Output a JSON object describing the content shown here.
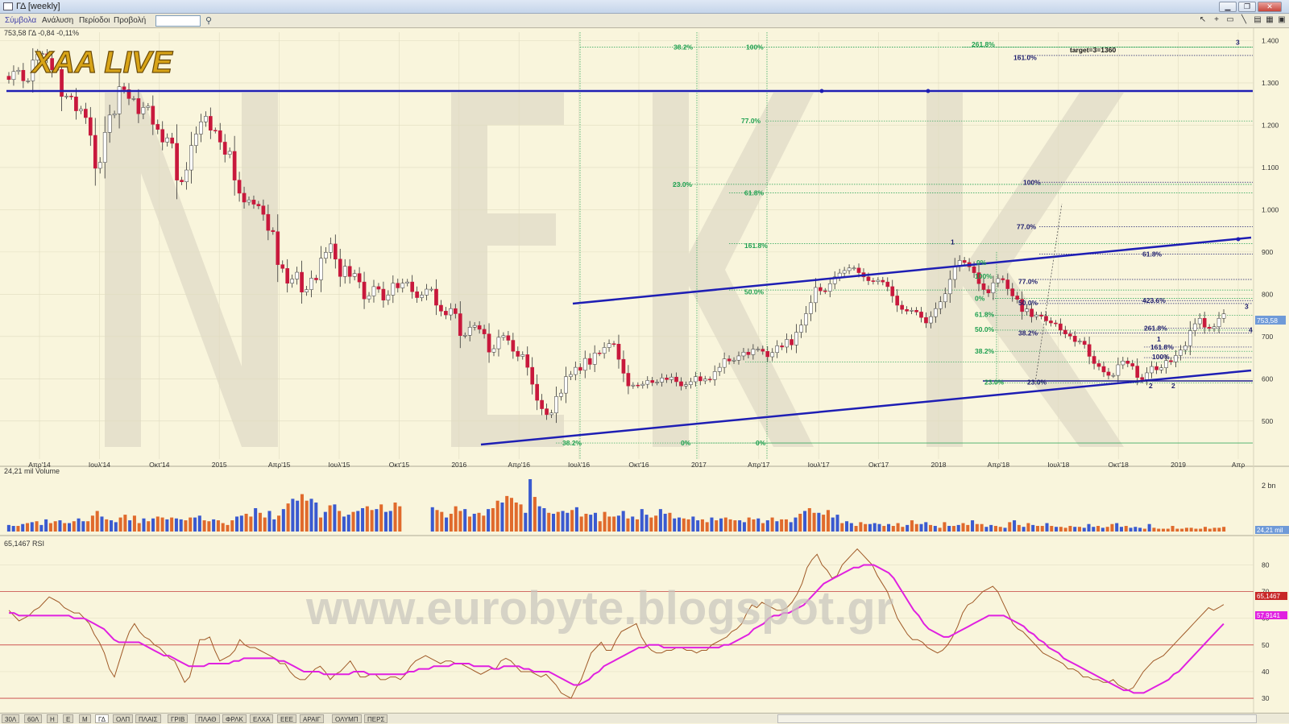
{
  "window": {
    "title": "ΓΔ [weekly]",
    "buttons": [
      "▁",
      "❐",
      "✕"
    ]
  },
  "menu": {
    "items": [
      "Σύμβολα",
      "Ανάλυση",
      "Περίοδοι",
      "Προβολή"
    ]
  },
  "toolbar_icons": [
    "cursor-icon",
    "crosshair-icon",
    "zoom-box-icon",
    "trendline-icon",
    "layout-icon",
    "grid-icon",
    "save-icon"
  ],
  "watermark": {
    "logo": "XAA LIVE",
    "letters": "NEK",
    "url": "www.eurobyte.blogspot.gr"
  },
  "colors": {
    "up": "#ffffff",
    "down": "#c8183c",
    "wick": "#333333",
    "trend": "#1e1eb4",
    "fib_green": "#1fa050",
    "fib_navy": "#1e1e6e",
    "vol_up": "#3a5ad0",
    "vol_down": "#e06a2c",
    "rsi": "#a05a28",
    "rsi_ma": "#e020e0",
    "rsi_level": "#c84040",
    "grid": "#e0dcc0"
  },
  "chart_data": [
    {
      "panel": "price",
      "type": "candlestick",
      "legend": "753,58 ΓΔ -0,84 -0,11%",
      "last_label": "753,58",
      "x_ticks": [
        "Απρ'14",
        "Ιουλ'14",
        "Οκτ'14",
        "2015",
        "Απρ'15",
        "Ιουλ'15",
        "Οκτ'15",
        "2016",
        "Απρ'16",
        "Ιουλ'16",
        "Οκτ'16",
        "2017",
        "Απρ'17",
        "Ιουλ'17",
        "Οκτ'17",
        "2018",
        "Απρ'18",
        "Ιουλ'18",
        "Οκτ'18",
        "2019",
        "Απρ"
      ],
      "y_ticks": [
        "1.400",
        "1.300",
        "1.200",
        "1.100",
        "1.000",
        "900",
        "800",
        "700",
        "600",
        "500"
      ],
      "ylim": [
        410,
        1420
      ],
      "closes": [
        1308,
        1327,
        1330,
        1305,
        1305,
        1354,
        1368,
        1369,
        1358,
        1331,
        1332,
        1268,
        1269,
        1267,
        1234,
        1238,
        1218,
        1176,
        1098,
        1112,
        1183,
        1224,
        1227,
        1291,
        1284,
        1263,
        1263,
        1227,
        1242,
        1245,
        1202,
        1190,
        1160,
        1170,
        1157,
        1070,
        1066,
        1094,
        1152,
        1179,
        1208,
        1221,
        1188,
        1187,
        1160,
        1131,
        1138,
        1070,
        1039,
        1018,
        1023,
        1013,
        1009,
        989,
        951,
        948,
        870,
        861,
        826,
        836,
        852,
        805,
        811,
        838,
        834,
        885,
        899,
        919,
        883,
        842,
        866,
        842,
        849,
        829,
        789,
        796,
        818,
        812,
        786,
        798,
        826,
        815,
        826,
        829,
        806,
        792,
        798,
        812,
        812,
        774,
        760,
        751,
        766,
        754,
        702,
        703,
        722,
        726,
        717,
        706,
        663,
        671,
        698,
        702,
        691,
        665,
        653,
        657,
        627,
        587,
        549,
        529,
        515,
        519,
        558,
        566,
        605,
        610,
        627,
        620,
        648,
        634,
        661,
        660,
        674,
        683,
        682,
        646,
        613,
        583,
        585,
        584,
        587,
        596,
        591,
        592,
        602,
        598,
        604,
        593,
        583,
        586,
        593,
        605,
        595,
        599,
        598,
        617,
        627,
        647,
        642,
        644,
        654,
        663,
        657,
        670,
        670,
        665,
        652,
        662,
        678,
        675,
        693,
        680,
        710,
        727,
        754,
        780,
        816,
        808,
        807,
        825,
        841,
        850,
        856,
        862,
        862,
        851,
        841,
        832,
        830,
        833,
        829,
        818,
        796,
        774,
        764,
        760,
        762,
        758,
        745,
        732,
        747,
        766,
        782,
        801,
        835,
        866,
        880,
        875,
        865,
        851,
        825,
        811,
        803,
        827,
        837,
        834,
        813,
        796,
        788,
        759,
        765,
        747,
        751,
        748,
        737,
        732,
        730,
        715,
        706,
        701,
        688,
        689,
        681,
        653,
        636,
        629,
        616,
        608,
        608,
        633,
        642,
        636,
        630,
        603,
        598,
        614,
        629,
        621,
        626,
        643,
        640,
        655,
        668,
        678,
        714,
        730,
        743,
        722,
        719,
        723,
        743,
        753.58
      ]
    },
    {
      "panel": "volume",
      "type": "bar",
      "legend": "24,21 mil Volume",
      "y_ticks": [
        "2 bn"
      ],
      "last_label": "24,21 mil",
      "values": [
        7,
        6,
        6,
        8,
        9,
        10,
        11,
        7,
        13,
        9,
        11,
        12,
        9,
        9,
        11,
        14,
        11,
        11,
        17,
        22,
        16,
        13,
        12,
        10,
        15,
        18,
        12,
        17,
        9,
        14,
        11,
        14,
        16,
        15,
        13,
        15,
        14,
        13,
        12,
        15,
        15,
        17,
        12,
        11,
        13,
        12,
        9,
        7,
        12,
        16,
        17,
        19,
        16,
        25,
        20,
        15,
        22,
        13,
        17,
        24,
        30,
        35,
        33,
        40,
        33,
        35,
        31,
        15,
        21,
        28,
        29,
        22,
        16,
        18,
        21,
        22,
        25,
        27,
        23,
        24,
        29,
        21,
        22,
        31,
        27,
        0,
        0,
        0,
        0,
        0,
        0,
        26,
        23,
        21,
        15,
        19,
        27,
        22,
        24,
        16,
        19,
        20,
        17,
        24,
        25,
        33,
        31,
        38,
        36,
        31,
        29,
        20,
        56,
        37,
        27,
        25,
        20,
        19,
        21,
        22,
        20,
        23,
        26,
        16,
        19,
        18,
        20,
        11,
        21,
        16,
        16,
        17,
        22,
        14,
        16,
        13,
        24,
        18,
        15,
        17,
        24,
        19,
        20,
        14,
        15,
        14,
        13,
        16,
        12,
        13,
        10,
        15,
        12,
        14,
        15,
        13,
        12,
        12,
        10,
        15,
        13,
        14,
        9,
        12,
        15,
        11,
        13,
        13,
        10,
        15,
        19,
        22,
        25,
        20,
        20,
        18,
        23,
        15,
        18,
        9,
        11,
        9,
        6,
        10,
        8,
        8,
        9,
        8,
        6,
        8,
        6,
        9,
        5,
        7,
        12,
        8,
        8,
        10,
        7,
        6,
        4,
        10,
        6,
        6,
        7,
        9,
        7,
        12,
        8,
        8,
        5,
        7,
        6,
        5,
        4,
        10,
        12,
        7,
        5,
        9,
        7,
        6,
        6,
        9,
        6,
        5,
        5,
        4,
        6,
        5,
        5,
        4,
        8,
        5,
        6,
        4,
        5,
        8,
        9,
        5,
        6,
        4,
        5,
        4,
        3,
        8,
        4,
        3,
        3,
        3,
        6,
        3,
        3,
        4,
        4,
        3,
        3,
        5,
        3,
        4,
        4,
        5
      ],
      "up": [
        true,
        true,
        false,
        true,
        false,
        true,
        false,
        true,
        true,
        false,
        false,
        true,
        false,
        true,
        false,
        true,
        true,
        false,
        false,
        false,
        true,
        false,
        true,
        true,
        false,
        false,
        true,
        false,
        false,
        true,
        false,
        true,
        false,
        false,
        true,
        false,
        true,
        true,
        false,
        false,
        true,
        true,
        false,
        false,
        true,
        false,
        false,
        false,
        false,
        true,
        true,
        false,
        false,
        true,
        false,
        false,
        true,
        true,
        false,
        true,
        false,
        true,
        true,
        false,
        false,
        true,
        true,
        false,
        true,
        false,
        true,
        false,
        true,
        true,
        false,
        true,
        true,
        false,
        false,
        true,
        false,
        true,
        true,
        false,
        false,
        true,
        true,
        false,
        false,
        false,
        false,
        true,
        false,
        false,
        true,
        false,
        false,
        false,
        true,
        false,
        true,
        false,
        false,
        true,
        false,
        false,
        true,
        false,
        false,
        false,
        false,
        true,
        true,
        false,
        true,
        true,
        false,
        true,
        false,
        true,
        true,
        false,
        true,
        false,
        false,
        true,
        true,
        false,
        false,
        false,
        false,
        true,
        true,
        false,
        true,
        false,
        true,
        true,
        false,
        false,
        true,
        true,
        false,
        true,
        true,
        false,
        false,
        true,
        true,
        false,
        false,
        true,
        false,
        true,
        false,
        false,
        false,
        true,
        true,
        false,
        false,
        true,
        false,
        true,
        false,
        true,
        false,
        false,
        true,
        true,
        false,
        true,
        false,
        false,
        true,
        false,
        false,
        true,
        true,
        false,
        true,
        true,
        false,
        false,
        false,
        true,
        true,
        true,
        false,
        true,
        false,
        false,
        false,
        true,
        false,
        false,
        true,
        true,
        false,
        true,
        false,
        false,
        true,
        false,
        true,
        false,
        false,
        true,
        false,
        false,
        true,
        true,
        false,
        false,
        true,
        false,
        true,
        false,
        true,
        false,
        true,
        false,
        false,
        true,
        false,
        true,
        false,
        false,
        false,
        true,
        false,
        true,
        true,
        true,
        false,
        true,
        false,
        false,
        true,
        true,
        false,
        true,
        true,
        true,
        false,
        true
      ]
    },
    {
      "panel": "rsi",
      "type": "line",
      "legend": "65,1467 RSI",
      "y_ticks": [
        "80",
        "70",
        "60",
        "50",
        "40",
        "30"
      ],
      "levels": [
        30,
        50,
        70
      ],
      "ylim": [
        27,
        88
      ],
      "rsi_label": "65,1467",
      "ma_label": "57,9141",
      "rsi": [
        63,
        61,
        59,
        60,
        61,
        63,
        64,
        66,
        68,
        67,
        66,
        64,
        63,
        62,
        62,
        60,
        58,
        54,
        51,
        47,
        41,
        38,
        44,
        50,
        55,
        58,
        55,
        53,
        52,
        50,
        49,
        47,
        45,
        44,
        40,
        36,
        38,
        45,
        52,
        52,
        53,
        48,
        44,
        45,
        46,
        48,
        52,
        50,
        49,
        49,
        48,
        47,
        46,
        45,
        43,
        43,
        40,
        38,
        37,
        37,
        39,
        41,
        42,
        40,
        37,
        39,
        40,
        42,
        44,
        41,
        38,
        38,
        39,
        39,
        37,
        37,
        38,
        38,
        37,
        39,
        42,
        44,
        45,
        46,
        45,
        44,
        43,
        44,
        44,
        43,
        43,
        42,
        41,
        40,
        39,
        40,
        41,
        41,
        44,
        45,
        44,
        42,
        40,
        40,
        40,
        39,
        38,
        39,
        37,
        35,
        32,
        31,
        30,
        34,
        37,
        42,
        47,
        49,
        51,
        48,
        48,
        52,
        55,
        56,
        57,
        58,
        53,
        50,
        48,
        47,
        47,
        48,
        48,
        49,
        49,
        48,
        48,
        47,
        48,
        48,
        50,
        51,
        52,
        53,
        55,
        56,
        58,
        62,
        65,
        64,
        66,
        65,
        64,
        63,
        63,
        64,
        66,
        69,
        73,
        79,
        82,
        84,
        80,
        78,
        75,
        76,
        80,
        82,
        84,
        86,
        84,
        82,
        80,
        76,
        73,
        70,
        65,
        60,
        57,
        54,
        52,
        52,
        51,
        49,
        48,
        47,
        48,
        50,
        53,
        57,
        62,
        65,
        66,
        68,
        70,
        71,
        72,
        70,
        66,
        62,
        58,
        56,
        55,
        53,
        51,
        49,
        47,
        46,
        45,
        44,
        43,
        41,
        41,
        40,
        38,
        38,
        37,
        37,
        36,
        36,
        37,
        35,
        34,
        33,
        34,
        37,
        40,
        42,
        44,
        45,
        46,
        48,
        50,
        52,
        54,
        56,
        58,
        60,
        62,
        64,
        63,
        64,
        65.1467
      ],
      "rsi_ma": [
        62,
        62,
        61,
        61,
        61,
        61,
        61,
        61,
        61,
        61,
        61,
        61,
        61,
        60,
        60,
        60,
        59,
        58,
        57,
        56,
        54,
        52,
        51,
        51,
        51,
        51,
        51,
        50,
        49,
        48,
        47,
        46,
        46,
        45,
        44,
        43,
        42,
        42,
        42,
        42,
        43,
        43,
        43,
        43,
        43,
        44,
        44,
        45,
        45,
        45,
        45,
        45,
        45,
        45,
        44,
        44,
        43,
        42,
        41,
        40,
        40,
        40,
        40,
        39,
        39,
        39,
        39,
        39,
        39,
        40,
        40,
        40,
        39,
        39,
        39,
        39,
        39,
        39,
        39,
        39,
        40,
        40,
        41,
        41,
        41,
        42,
        42,
        42,
        42,
        43,
        43,
        43,
        43,
        42,
        42,
        42,
        42,
        41,
        41,
        42,
        42,
        42,
        42,
        41,
        41,
        40,
        40,
        40,
        40,
        39,
        38,
        37,
        36,
        35,
        35,
        36,
        37,
        39,
        40,
        42,
        43,
        44,
        45,
        46,
        47,
        48,
        49,
        49,
        50,
        50,
        50,
        49,
        49,
        49,
        49,
        49,
        49,
        49,
        49,
        49,
        49,
        49,
        49,
        50,
        50,
        51,
        52,
        53,
        54,
        56,
        57,
        58,
        60,
        61,
        61,
        62,
        62,
        63,
        64,
        65,
        67,
        69,
        71,
        73,
        74,
        75,
        76,
        77,
        78,
        79,
        79,
        80,
        80,
        80,
        79,
        78,
        77,
        75,
        72,
        69,
        66,
        63,
        61,
        58,
        56,
        55,
        54,
        53,
        53,
        54,
        55,
        56,
        57,
        58,
        59,
        60,
        61,
        61,
        61,
        61,
        60,
        59,
        58,
        57,
        55,
        54,
        52,
        51,
        49,
        48,
        47,
        45,
        44,
        43,
        42,
        41,
        40,
        39,
        38,
        37,
        36,
        35,
        34,
        33,
        33,
        32,
        32,
        32,
        33,
        34,
        35,
        36,
        37,
        39,
        40,
        42,
        44,
        46,
        48,
        50,
        52,
        54,
        56,
        57.9141
      ]
    }
  ],
  "annotations": {
    "target": "target=3=1360",
    "fib_green": [
      "38.2%",
      "100%",
      "261.8%",
      "77.0%",
      "23.0%",
      "61.8%",
      "161.8%",
      "50.0%",
      "38.2%",
      "0%",
      "0%",
      "0%",
      "61.8%",
      "50.0%",
      "38.2%",
      "23.0%",
      "0%",
      "100%",
      "50.0%"
    ],
    "fib_navy": [
      "161.0%",
      "100%",
      "77.0%",
      "61.8%",
      "423.6%",
      "261.8%",
      "161.8%",
      "100%",
      "77.0%",
      "50.0%",
      "38.2%",
      "23.0%",
      "0%"
    ],
    "waves": [
      "1",
      "2",
      "3",
      "4",
      "1",
      "2",
      "3"
    ]
  },
  "bottom_tabs": [
    "30Λ",
    "60Λ",
    "Η",
    "Ε",
    "Μ",
    "ΓΔ",
    "ΟΛΠ",
    "ΠΛΑΙΣ",
    "ΓΡΙΒ",
    "ΠΛΑΘ",
    "ΦΡΛΚ",
    "ΕΛΧΑ",
    "ΕΕΕ",
    "ΑΡΑΙΓ",
    "ΟΛΥΜΠ",
    "ΠΕΡΣ"
  ]
}
